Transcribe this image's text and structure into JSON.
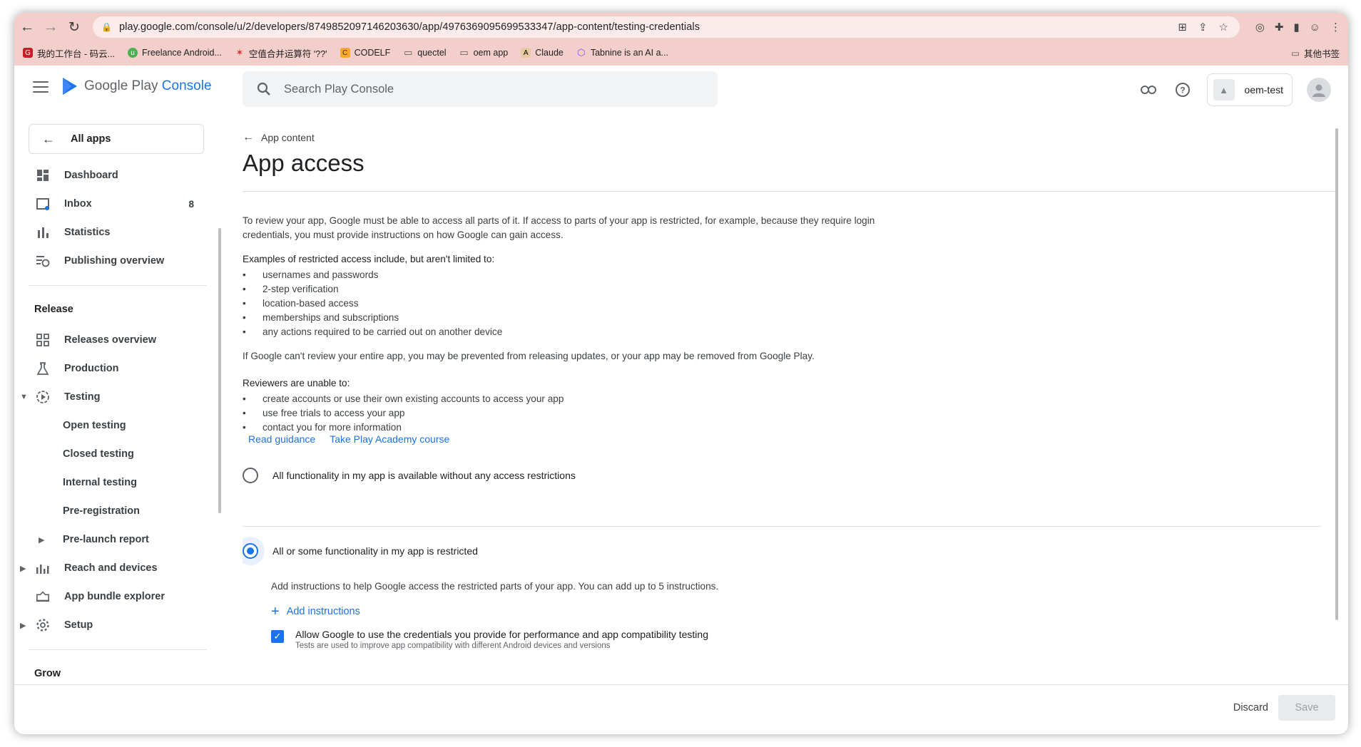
{
  "browser": {
    "url": "play.google.com/console/u/2/developers/8749852097146203630/app/4976369095699533347/app-content/testing-credentials",
    "bookmarks": [
      {
        "label": "我的工作台 - 码云...",
        "color": "#c71d23"
      },
      {
        "label": "Freelance Android...",
        "color": "#4caf50"
      },
      {
        "label": "空值合并运算符 '??'",
        "color": "#d32f2f"
      },
      {
        "label": "CODELF",
        "color": "#f9a825"
      },
      {
        "label": "quectel",
        "color": "folder"
      },
      {
        "label": "oem app",
        "color": "folder"
      },
      {
        "label": "Claude",
        "color": "#c96442"
      },
      {
        "label": "Tabnine is an AI a...",
        "color": "#7c4dff"
      }
    ],
    "other_bookmarks": "其他书签"
  },
  "header": {
    "logo_google_play": "Google Play",
    "logo_console": "Console",
    "search_placeholder": "Search Play Console",
    "developer_name": "oem-test"
  },
  "sidebar": {
    "all_apps": "All apps",
    "items_top": [
      {
        "label": "Dashboard",
        "icon": "dashboard-icon"
      },
      {
        "label": "Inbox",
        "icon": "inbox-icon",
        "badge": "8"
      },
      {
        "label": "Statistics",
        "icon": "statistics-icon"
      },
      {
        "label": "Publishing overview",
        "icon": "publishing-icon"
      }
    ],
    "release_section": "Release",
    "releases_overview": "Releases overview",
    "production": "Production",
    "testing": "Testing",
    "open_testing": "Open testing",
    "closed_testing": "Closed testing",
    "internal_testing": "Internal testing",
    "pre_registration": "Pre-registration",
    "pre_launch_report": "Pre-launch report",
    "reach_and_devices": "Reach and devices",
    "app_bundle_explorer": "App bundle explorer",
    "setup": "Setup",
    "grow_section": "Grow"
  },
  "main": {
    "back_label": "App content",
    "title": "App access",
    "intro": "To review your app, Google must be able to access all parts of it. If access to parts of your app is restricted, for example, because they require login credentials, you must provide instructions on how Google can gain access.",
    "examples_heading": "Examples of restricted access include, but aren't limited to:",
    "examples": [
      "usernames and passwords",
      "2-step verification",
      "location-based access",
      "memberships and subscriptions",
      "any actions required to be carried out on another device"
    ],
    "warning": "If Google can't review your entire app, you may be prevented from releasing updates, or your app may be removed from Google Play.",
    "reviewers_heading": "Reviewers are unable to:",
    "reviewers": [
      "create accounts or use their own existing accounts to access your app",
      "use free trials to access your app",
      "contact you for more information"
    ],
    "read_guidance": "Read guidance",
    "academy_course": "Take Play Academy course",
    "option_unrestricted": "All functionality in my app is available without any access restrictions",
    "option_restricted": "All or some functionality in my app is restricted",
    "instructions_text": "Add instructions to help Google access the restricted parts of your app. You can add up to 5 instructions.",
    "add_instructions": "Add instructions",
    "allow_label": "Allow Google to use the credentials you provide for performance and app compatibility testing",
    "allow_sublabel": "Tests are used to improve app compatibility with different Android devices and versions",
    "allow_checked": true
  },
  "footer": {
    "discard": "Discard",
    "save": "Save"
  }
}
